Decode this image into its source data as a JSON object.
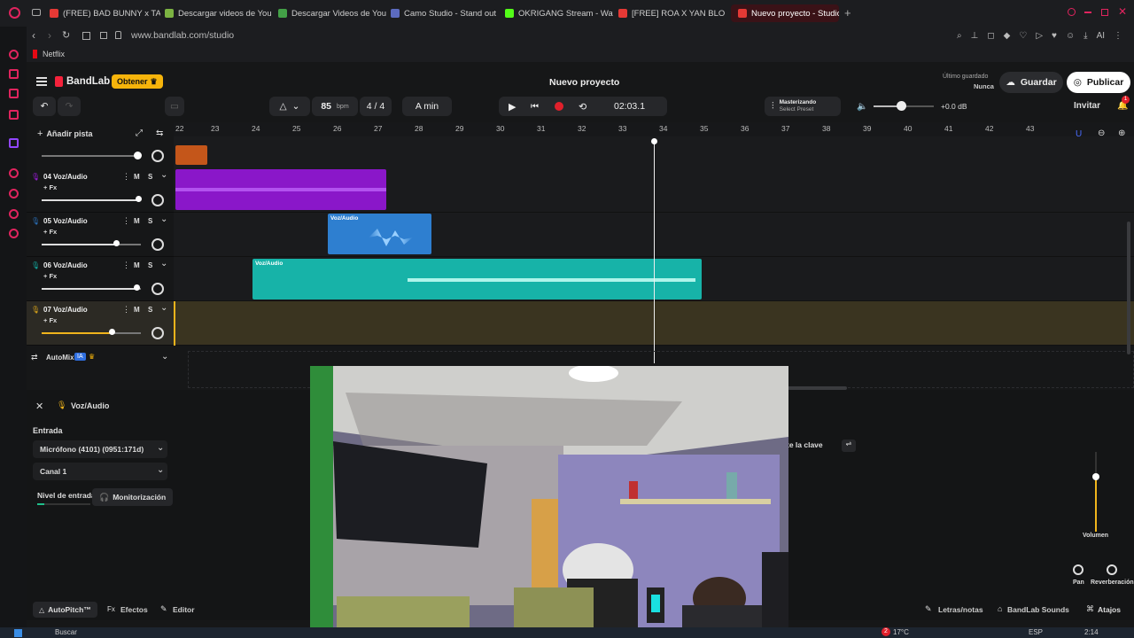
{
  "browser": {
    "tabs": [
      {
        "label": "(FREE) BAD BUNNY x TAIN",
        "color": "#e53935"
      },
      {
        "label": "Descargar videos de YouT",
        "color": "#7cb342"
      },
      {
        "label": "Descargar Videos de YouT",
        "color": "#43a047"
      },
      {
        "label": "Camo Studio - Stand out",
        "color": "#5c6bc0"
      },
      {
        "label": "OKRIGANG Stream - Watc",
        "color": "#53fc18"
      },
      {
        "label": "[FREE] ROA X YAN BLOCK",
        "color": "#e53935"
      },
      {
        "label": "Nuevo proyecto - Studio",
        "color": "#e53935"
      }
    ],
    "url": "www.bandlab.com/studio",
    "bookmark": "Netflix",
    "ai_label": "AI"
  },
  "header": {
    "logo": "BandLab",
    "obtener": "Obtener",
    "project_title": "Nuevo proyecto",
    "last_saved_label": "Último guardado",
    "last_saved_value": "Nunca",
    "save": "Guardar",
    "publish": "Publicar"
  },
  "toolbar": {
    "bpm": "85",
    "bpm_unit": "bpm",
    "time_sig": "4 / 4",
    "key": "A min",
    "time": "02:03.1",
    "mastering_title": "Masterizando",
    "mastering_sub": "Select Preset",
    "db": "+0.0 dB",
    "volume_level": 0.45,
    "invite": "Invitar",
    "notif_count": "1"
  },
  "tracks_panel": {
    "add_track": "Añadir pista",
    "automix": "AutoMix",
    "automix_badge": "IA"
  },
  "ruler": [
    "22",
    "23",
    "24",
    "25",
    "26",
    "27",
    "28",
    "29",
    "30",
    "31",
    "32",
    "33",
    "34",
    "35",
    "36",
    "37",
    "38",
    "39",
    "40",
    "41",
    "42",
    "43"
  ],
  "tracks": [
    {
      "name": "04 Voz/Audio",
      "fx": "+ Fx",
      "mute": "M",
      "solo": "S",
      "level": 0.98,
      "color": "#9b1bd8"
    },
    {
      "name": "05 Voz/Audio",
      "fx": "+ Fx",
      "mute": "M",
      "solo": "S",
      "level": 0.75,
      "color": "#2a6fb8"
    },
    {
      "name": "06 Voz/Audio",
      "fx": "+ Fx",
      "mute": "M",
      "solo": "S",
      "level": 0.96,
      "color": "#13a89e"
    },
    {
      "name": "07 Voz/Audio",
      "fx": "+ Fx",
      "mute": "M",
      "solo": "S",
      "level": 0.7,
      "color": "#d8a31a"
    }
  ],
  "clips": [
    {
      "label": "Voz/Audio",
      "color": "#2e7fd0"
    },
    {
      "label": "Voz/Audio",
      "color": "#17b3a8"
    }
  ],
  "input_panel": {
    "title": "Voz/Audio",
    "entrada": "Entrada",
    "mic": "Micrófono (4101) (0951:171d)",
    "channel": "Canal 1",
    "nivel": "Nivel de entrada",
    "monitor": "Monitorización",
    "key_btn": "te la clave",
    "volumen": "Volumen",
    "pan": "Pan",
    "reverb": "Reverberación"
  },
  "bottom": {
    "autopitch": "AutoPitch™",
    "efectos": "Efectos",
    "editor": "Editor",
    "letras": "Letras/notas",
    "sounds": "BandLab Sounds",
    "atajos": "Atajos"
  },
  "taskbar": {
    "search": "Buscar",
    "temp": "17°C",
    "lang": "ESP",
    "clock": "2:14",
    "badge": "2"
  }
}
